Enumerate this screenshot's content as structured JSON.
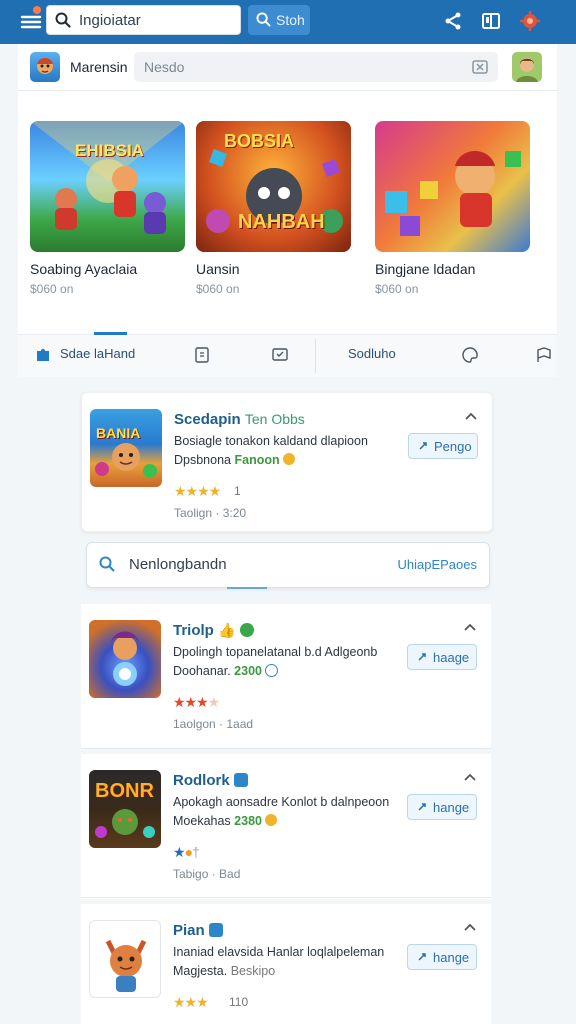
{
  "topbar": {
    "search_value": "Ingioiatar",
    "search_button": "Stoh",
    "icons": [
      "menu-icon",
      "search-icon",
      "share-icon",
      "bookmark-icon",
      "settings-gear-icon"
    ]
  },
  "subheader": {
    "app_name": "Marensin",
    "field_placeholder": "Nesdo"
  },
  "featured": [
    {
      "title": "Soabing Ayaclaia",
      "sub": "$060 on",
      "thumb_text": "EHIBSIA"
    },
    {
      "title": "Uansin",
      "sub": "$060 on",
      "thumb_text": "NAHBAH",
      "thumb_text2": "BOBSIA"
    },
    {
      "title": "Bingjane ldadan",
      "sub": "$060 on"
    }
  ],
  "tabs": [
    {
      "label": "Sdae laHand"
    },
    {
      "label": "Sodluho"
    }
  ],
  "cards": [
    {
      "title": "Scedapin",
      "tag": "Ten Obbs",
      "line1": "Bosiagle tonakon kaldand dlapioon",
      "line2_pre": "Dpsbnona",
      "line2_val": "Fanoon",
      "stars": "★★★★",
      "count": "1",
      "time": "Taolign · 3:20",
      "action": "Pengo",
      "icon_text": "BANIA"
    },
    {
      "title": "Triolp",
      "tag": "",
      "line1": "Dpolingh topanelatanal b.d Adlgeonb",
      "line2_pre": "Doohanar.",
      "line2_val": "2300",
      "stars": "★★★",
      "count": "",
      "time": "1aolgon · 1aad",
      "action": "haage"
    },
    {
      "title": "Rodlork",
      "tag": "",
      "line1": "Apokagh aonsadre Konlot b dalnpeoon",
      "line2_pre": "Moekahas",
      "line2_val": "2380",
      "stars": "",
      "count": "",
      "time": "Tabigo · Bad",
      "action": "hange",
      "icon_text": "BONR"
    },
    {
      "title": "Pian",
      "tag": "",
      "line1": "Inaniad elavsida Hanlar loqlalpeleman",
      "line2_pre": "Magjesta.",
      "line2_val": "Beskipo",
      "stars": "★★★",
      "count": "110",
      "time": "",
      "action": "hange"
    }
  ],
  "inline_search": {
    "value": "Nenlongbandn",
    "link": "UhiapEPaoes"
  },
  "colors": {
    "topbar": "#1f6fb2",
    "accent": "#1f7ac8",
    "star": "#f2b12a",
    "price": "#3a9a3d"
  }
}
